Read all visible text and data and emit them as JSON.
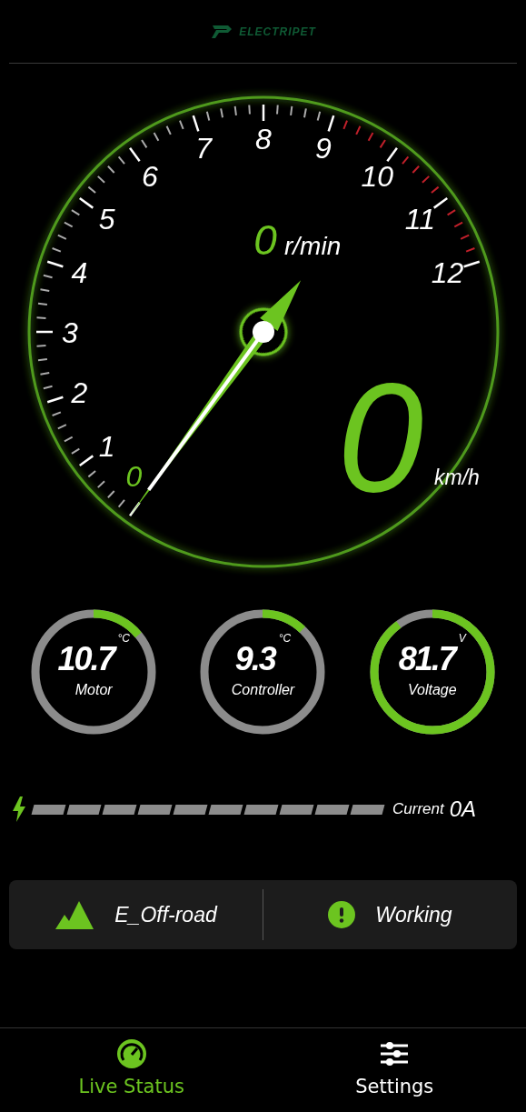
{
  "header": {
    "brand": "ELECTRIPET"
  },
  "tachometer": {
    "scale_labels": [
      {
        "label": "0",
        "redline": false
      },
      {
        "label": "1",
        "redline": false
      },
      {
        "label": "2",
        "redline": false
      },
      {
        "label": "3",
        "redline": false
      },
      {
        "label": "4",
        "redline": false
      },
      {
        "label": "5",
        "redline": false
      },
      {
        "label": "6",
        "redline": false
      },
      {
        "label": "7",
        "redline": false
      },
      {
        "label": "8",
        "redline": false
      },
      {
        "label": "9",
        "redline": true
      },
      {
        "label": "10",
        "redline": true
      },
      {
        "label": "11",
        "redline": true
      },
      {
        "label": "12",
        "redline": false
      }
    ],
    "rpm": {
      "value": "0",
      "unit": "r/min"
    },
    "speed": {
      "value": "0",
      "unit": "km/h"
    }
  },
  "sensors": [
    {
      "value": "10.7",
      "unit": "°C",
      "label": "Motor"
    },
    {
      "value": "9.3",
      "unit": "°C",
      "label": "Controller"
    },
    {
      "value": "81.7",
      "unit": "V",
      "label": "Voltage"
    }
  ],
  "current": {
    "label": "Current",
    "value": "0A"
  },
  "status": {
    "mode": "E_Off-road",
    "state": "Working"
  },
  "nav": [
    {
      "label": "Live Status",
      "selected": true
    },
    {
      "label": "Settings",
      "selected": false
    }
  ]
}
